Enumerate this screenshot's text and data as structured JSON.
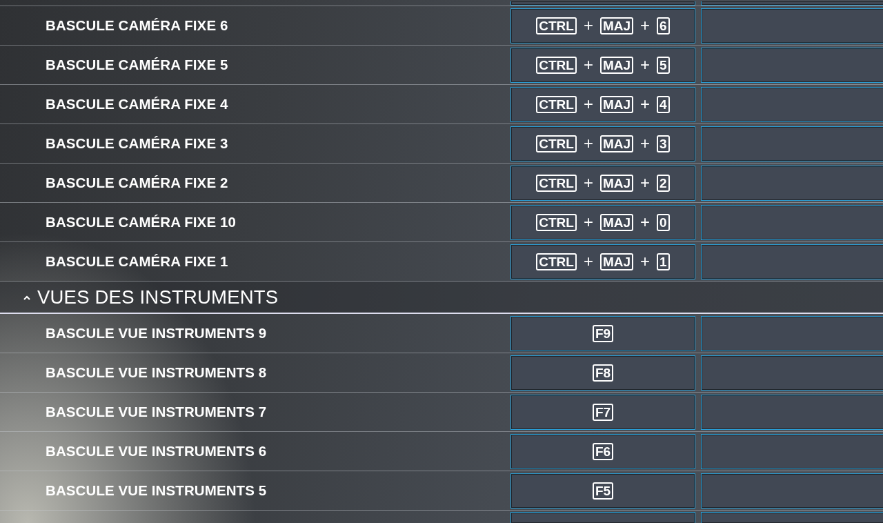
{
  "bindings": [
    {
      "kind": "cut_top"
    },
    {
      "kind": "row",
      "action": "BASCULE CAMÉRA FIXE 6",
      "combo": [
        {
          "kind": "key",
          "text": "CTRL"
        },
        {
          "kind": "sep",
          "text": "+"
        },
        {
          "kind": "key",
          "text": "MAJ"
        },
        {
          "kind": "sep",
          "text": "+"
        },
        {
          "kind": "key",
          "text": "6"
        }
      ]
    },
    {
      "kind": "row",
      "action": "BASCULE CAMÉRA FIXE 5",
      "combo": [
        {
          "kind": "key",
          "text": "CTRL"
        },
        {
          "kind": "sep",
          "text": "+"
        },
        {
          "kind": "key",
          "text": "MAJ"
        },
        {
          "kind": "sep",
          "text": "+"
        },
        {
          "kind": "key",
          "text": "5"
        }
      ]
    },
    {
      "kind": "row",
      "action": "BASCULE CAMÉRA FIXE 4",
      "combo": [
        {
          "kind": "key",
          "text": "CTRL"
        },
        {
          "kind": "sep",
          "text": "+"
        },
        {
          "kind": "key",
          "text": "MAJ"
        },
        {
          "kind": "sep",
          "text": "+"
        },
        {
          "kind": "key",
          "text": "4"
        }
      ]
    },
    {
      "kind": "row",
      "action": "BASCULE CAMÉRA FIXE 3",
      "combo": [
        {
          "kind": "key",
          "text": "CTRL"
        },
        {
          "kind": "sep",
          "text": "+"
        },
        {
          "kind": "key",
          "text": "MAJ"
        },
        {
          "kind": "sep",
          "text": "+"
        },
        {
          "kind": "key",
          "text": "3"
        }
      ]
    },
    {
      "kind": "row",
      "action": "BASCULE CAMÉRA FIXE 2",
      "combo": [
        {
          "kind": "key",
          "text": "CTRL"
        },
        {
          "kind": "sep",
          "text": "+"
        },
        {
          "kind": "key",
          "text": "MAJ"
        },
        {
          "kind": "sep",
          "text": "+"
        },
        {
          "kind": "key",
          "text": "2"
        }
      ]
    },
    {
      "kind": "row",
      "action": "BASCULE CAMÉRA FIXE 10",
      "combo": [
        {
          "kind": "key",
          "text": "CTRL"
        },
        {
          "kind": "sep",
          "text": "+"
        },
        {
          "kind": "key",
          "text": "MAJ"
        },
        {
          "kind": "sep",
          "text": "+"
        },
        {
          "kind": "key",
          "text": "0"
        }
      ]
    },
    {
      "kind": "row",
      "action": "BASCULE CAMÉRA FIXE 1",
      "combo": [
        {
          "kind": "key",
          "text": "CTRL"
        },
        {
          "kind": "sep",
          "text": "+"
        },
        {
          "kind": "key",
          "text": "MAJ"
        },
        {
          "kind": "sep",
          "text": "+"
        },
        {
          "kind": "key",
          "text": "1"
        }
      ]
    }
  ],
  "section": {
    "title": "VUES DES INSTRUMENTS",
    "expanded": true,
    "bindings": [
      {
        "kind": "row",
        "action": "BASCULE VUE INSTRUMENTS 9",
        "combo": [
          {
            "kind": "key",
            "text": "F9"
          }
        ]
      },
      {
        "kind": "row",
        "action": "BASCULE VUE INSTRUMENTS 8",
        "combo": [
          {
            "kind": "key",
            "text": "F8"
          }
        ]
      },
      {
        "kind": "row",
        "action": "BASCULE VUE INSTRUMENTS 7",
        "combo": [
          {
            "kind": "key",
            "text": "F7"
          }
        ]
      },
      {
        "kind": "row",
        "action": "BASCULE VUE INSTRUMENTS 6",
        "combo": [
          {
            "kind": "key",
            "text": "F6"
          }
        ]
      },
      {
        "kind": "row",
        "action": "BASCULE VUE INSTRUMENTS 5",
        "combo": [
          {
            "kind": "key",
            "text": "F5"
          }
        ]
      },
      {
        "kind": "cut_bottom"
      }
    ]
  }
}
